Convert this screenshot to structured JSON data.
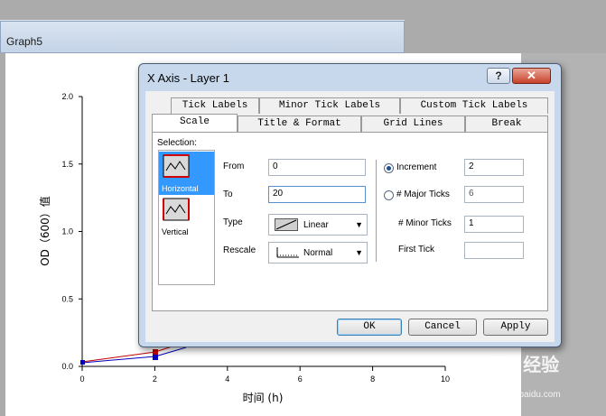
{
  "graph": {
    "tab_label": "Graph5",
    "y_axis_title": "OD（600）值",
    "x_axis_title": "时间 (h)",
    "y_ticks": [
      "0.0",
      "0.5",
      "1.0",
      "1.5",
      "2.0"
    ],
    "x_ticks": [
      "0",
      "2",
      "4",
      "6",
      "8",
      "10"
    ]
  },
  "dialog": {
    "title": "X Axis - Layer 1",
    "help_label": "?",
    "close_label": "✕",
    "tabs_row1": [
      "Tick Labels",
      "Minor Tick Labels",
      "Custom Tick Labels"
    ],
    "tabs_row2": [
      "Scale",
      "Title & Format",
      "Grid Lines",
      "Break"
    ],
    "active_tab": "Scale",
    "selection_label": "Selection:",
    "selection_items": [
      "Horizontal",
      "Vertical"
    ],
    "selected_item": "Horizontal",
    "from_label": "From",
    "from_value": "0",
    "to_label": "To",
    "to_value": "20",
    "type_label": "Type",
    "type_value": "Linear",
    "rescale_label": "Rescale",
    "rescale_value": "Normal",
    "increment_label": "Increment",
    "increment_value": "2",
    "major_ticks_label": "# Major Ticks",
    "major_ticks_value": "6",
    "minor_ticks_label": "# Minor Ticks",
    "minor_ticks_value": "1",
    "first_tick_label": "First Tick",
    "first_tick_value": "",
    "ok_label": "OK",
    "cancel_label": "Cancel",
    "apply_label": "Apply"
  },
  "watermark": {
    "brand": "Baidu 经验",
    "url": "jingyan.baidu.com"
  },
  "colors": {
    "selected": "#3399ff",
    "dialog_frame": "#c7d8ed",
    "close": "#c7432b"
  }
}
